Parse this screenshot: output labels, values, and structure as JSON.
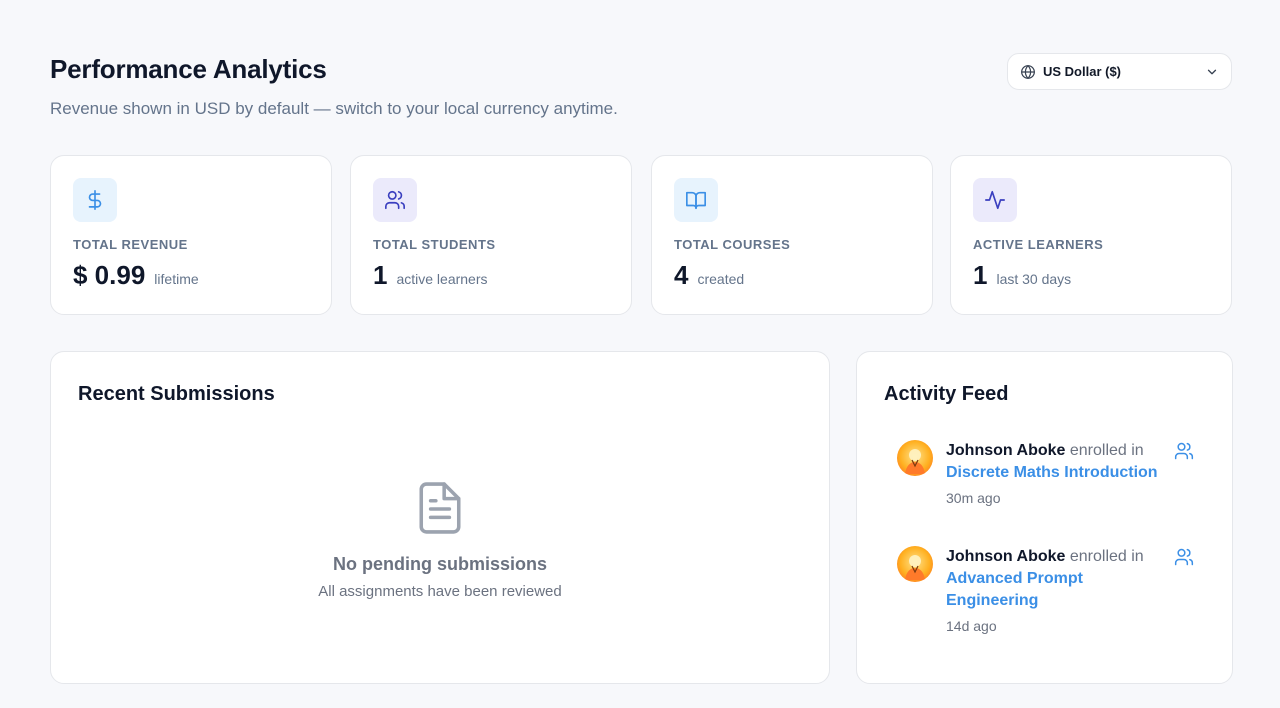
{
  "header": {
    "title": "Performance Analytics",
    "subtitle": "Revenue shown in USD by default — switch to your local currency anytime."
  },
  "currency": {
    "selected": "US Dollar ($)",
    "icon": "globe-icon"
  },
  "stats": [
    {
      "label": "TOTAL REVENUE",
      "value": "$ 0.99",
      "caption": "lifetime",
      "icon": "dollar-icon",
      "icon_color": "#3b8fe6",
      "icon_bg": "#e7f3fd"
    },
    {
      "label": "TOTAL STUDENTS",
      "value": "1",
      "caption": "active learners",
      "icon": "users-icon",
      "icon_color": "#3a3fbf",
      "icon_bg": "#ebeafb"
    },
    {
      "label": "TOTAL COURSES",
      "value": "4",
      "caption": "created",
      "icon": "book-icon",
      "icon_color": "#3b8fe6",
      "icon_bg": "#e7f3fd"
    },
    {
      "label": "ACTIVE LEARNERS",
      "value": "1",
      "caption": "last 30 days",
      "icon": "activity-icon",
      "icon_color": "#3a3fbf",
      "icon_bg": "#ebeafb"
    }
  ],
  "submissions": {
    "title": "Recent Submissions",
    "empty_title": "No pending submissions",
    "empty_subtitle": "All assignments have been reviewed",
    "empty_icon": "document-icon"
  },
  "activity": {
    "title": "Activity Feed",
    "items": [
      {
        "name": "Johnson Aboke",
        "verb": "enrolled in",
        "course": "Discrete Maths Introduction",
        "time": "30m ago"
      },
      {
        "name": "Johnson Aboke",
        "verb": "enrolled in",
        "course": "Advanced Prompt Engineering",
        "time": "14d ago"
      }
    ]
  },
  "colors": {
    "accent_blue": "#3b8fe6",
    "accent_indigo": "#3a3fbf",
    "text_muted": "#64748b"
  }
}
